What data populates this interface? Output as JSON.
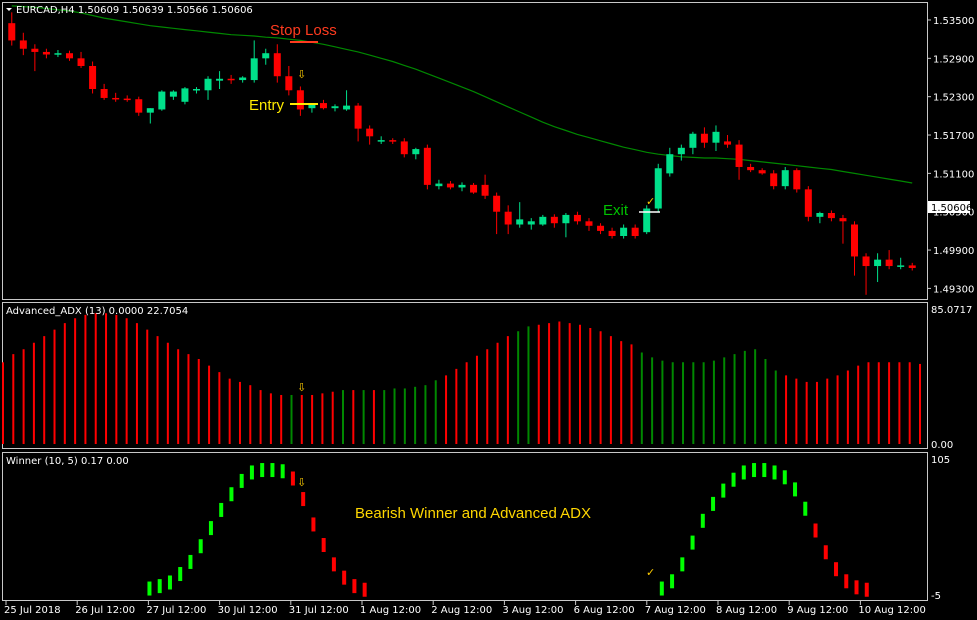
{
  "chart_data": [
    {
      "type": "candlestick",
      "title": "EURCAD,H4 1.50609 1.50639 1.50566 1.50606",
      "y_ticks": [
        "1.53500",
        "1.52900",
        "1.52300",
        "1.51700",
        "1.51100",
        "1.50500",
        "1.49900",
        "1.49300"
      ],
      "ylim": [
        1.4915,
        1.5375
      ],
      "current_price": "1.50606",
      "up_color": "#00e08a",
      "down_color": "#ff0000",
      "ma_color": "#008800",
      "candles": [
        {
          "o": 1.5345,
          "h": 1.5362,
          "l": 1.531,
          "c": 1.5318
        },
        {
          "o": 1.5318,
          "h": 1.533,
          "l": 1.5295,
          "c": 1.5305
        },
        {
          "o": 1.5305,
          "h": 1.5312,
          "l": 1.527,
          "c": 1.53
        },
        {
          "o": 1.53,
          "h": 1.5305,
          "l": 1.529,
          "c": 1.5296
        },
        {
          "o": 1.5296,
          "h": 1.5303,
          "l": 1.5292,
          "c": 1.5298
        },
        {
          "o": 1.5298,
          "h": 1.5302,
          "l": 1.5286,
          "c": 1.529
        },
        {
          "o": 1.529,
          "h": 1.53,
          "l": 1.5275,
          "c": 1.5278
        },
        {
          "o": 1.5278,
          "h": 1.5285,
          "l": 1.5235,
          "c": 1.5242
        },
        {
          "o": 1.5242,
          "h": 1.525,
          "l": 1.5225,
          "c": 1.5228
        },
        {
          "o": 1.5228,
          "h": 1.5236,
          "l": 1.5222,
          "c": 1.5227
        },
        {
          "o": 1.5227,
          "h": 1.5232,
          "l": 1.5222,
          "c": 1.5226
        },
        {
          "o": 1.5226,
          "h": 1.523,
          "l": 1.52,
          "c": 1.5205
        },
        {
          "o": 1.5205,
          "h": 1.5212,
          "l": 1.5188,
          "c": 1.5212
        },
        {
          "o": 1.521,
          "h": 1.524,
          "l": 1.5208,
          "c": 1.5238
        },
        {
          "o": 1.523,
          "h": 1.524,
          "l": 1.5225,
          "c": 1.5238
        },
        {
          "o": 1.5222,
          "h": 1.5245,
          "l": 1.5218,
          "c": 1.5243
        },
        {
          "o": 1.524,
          "h": 1.5245,
          "l": 1.5235,
          "c": 1.5242
        },
        {
          "o": 1.524,
          "h": 1.5262,
          "l": 1.5225,
          "c": 1.5258
        },
        {
          "o": 1.5255,
          "h": 1.527,
          "l": 1.5242,
          "c": 1.5258
        },
        {
          "o": 1.5258,
          "h": 1.5264,
          "l": 1.525,
          "c": 1.5256
        },
        {
          "o": 1.5256,
          "h": 1.5262,
          "l": 1.5252,
          "c": 1.526
        },
        {
          "o": 1.5256,
          "h": 1.5318,
          "l": 1.5252,
          "c": 1.529
        },
        {
          "o": 1.529,
          "h": 1.5305,
          "l": 1.528,
          "c": 1.5298
        },
        {
          "o": 1.5298,
          "h": 1.5312,
          "l": 1.5252,
          "c": 1.5262
        },
        {
          "o": 1.5262,
          "h": 1.5278,
          "l": 1.5232,
          "c": 1.524
        },
        {
          "o": 1.524,
          "h": 1.5246,
          "l": 1.52,
          "c": 1.521
        },
        {
          "o": 1.5212,
          "h": 1.522,
          "l": 1.5205,
          "c": 1.522
        },
        {
          "o": 1.522,
          "h": 1.5225,
          "l": 1.521,
          "c": 1.5212
        },
        {
          "o": 1.5212,
          "h": 1.5218,
          "l": 1.5207,
          "c": 1.5215
        },
        {
          "o": 1.521,
          "h": 1.524,
          "l": 1.5208,
          "c": 1.5216
        },
        {
          "o": 1.5216,
          "h": 1.522,
          "l": 1.516,
          "c": 1.518
        },
        {
          "o": 1.518,
          "h": 1.5185,
          "l": 1.5155,
          "c": 1.5168
        },
        {
          "o": 1.516,
          "h": 1.5168,
          "l": 1.5156,
          "c": 1.5162
        },
        {
          "o": 1.5162,
          "h": 1.5165,
          "l": 1.5156,
          "c": 1.516
        },
        {
          "o": 1.516,
          "h": 1.5165,
          "l": 1.5135,
          "c": 1.514
        },
        {
          "o": 1.514,
          "h": 1.515,
          "l": 1.5132,
          "c": 1.5148
        },
        {
          "o": 1.515,
          "h": 1.5155,
          "l": 1.5085,
          "c": 1.5092
        },
        {
          "o": 1.509,
          "h": 1.51,
          "l": 1.5085,
          "c": 1.5094
        },
        {
          "o": 1.5094,
          "h": 1.5098,
          "l": 1.5085,
          "c": 1.5088
        },
        {
          "o": 1.5088,
          "h": 1.5096,
          "l": 1.5082,
          "c": 1.5092
        },
        {
          "o": 1.5092,
          "h": 1.5095,
          "l": 1.5078,
          "c": 1.508
        },
        {
          "o": 1.5092,
          "h": 1.5108,
          "l": 1.507,
          "c": 1.5075
        },
        {
          "o": 1.5075,
          "h": 1.508,
          "l": 1.5015,
          "c": 1.505
        },
        {
          "o": 1.505,
          "h": 1.506,
          "l": 1.5015,
          "c": 1.503
        },
        {
          "o": 1.503,
          "h": 1.5065,
          "l": 1.5025,
          "c": 1.5038
        },
        {
          "o": 1.503,
          "h": 1.504,
          "l": 1.5022,
          "c": 1.5035
        },
        {
          "o": 1.503,
          "h": 1.5045,
          "l": 1.5028,
          "c": 1.5042
        },
        {
          "o": 1.5042,
          "h": 1.5046,
          "l": 1.5025,
          "c": 1.5032
        },
        {
          "o": 1.5032,
          "h": 1.5048,
          "l": 1.501,
          "c": 1.5045
        },
        {
          "o": 1.5045,
          "h": 1.505,
          "l": 1.503,
          "c": 1.5035
        },
        {
          "o": 1.5035,
          "h": 1.504,
          "l": 1.502,
          "c": 1.5028
        },
        {
          "o": 1.5028,
          "h": 1.5032,
          "l": 1.5015,
          "c": 1.502
        },
        {
          "o": 1.502,
          "h": 1.5025,
          "l": 1.5008,
          "c": 1.5012
        },
        {
          "o": 1.5012,
          "h": 1.503,
          "l": 1.5008,
          "c": 1.5025
        },
        {
          "o": 1.5025,
          "h": 1.503,
          "l": 1.5008,
          "c": 1.5012
        },
        {
          "o": 1.5018,
          "h": 1.506,
          "l": 1.5015,
          "c": 1.5055
        },
        {
          "o": 1.5055,
          "h": 1.5125,
          "l": 1.505,
          "c": 1.5118
        },
        {
          "o": 1.511,
          "h": 1.515,
          "l": 1.5105,
          "c": 1.514
        },
        {
          "o": 1.514,
          "h": 1.5155,
          "l": 1.513,
          "c": 1.515
        },
        {
          "o": 1.515,
          "h": 1.5175,
          "l": 1.514,
          "c": 1.5172
        },
        {
          "o": 1.5172,
          "h": 1.5182,
          "l": 1.515,
          "c": 1.5158
        },
        {
          "o": 1.5158,
          "h": 1.5185,
          "l": 1.5145,
          "c": 1.5175
        },
        {
          "o": 1.516,
          "h": 1.517,
          "l": 1.515,
          "c": 1.5155
        },
        {
          "o": 1.5155,
          "h": 1.5162,
          "l": 1.51,
          "c": 1.512
        },
        {
          "o": 1.512,
          "h": 1.5125,
          "l": 1.5112,
          "c": 1.5115
        },
        {
          "o": 1.5115,
          "h": 1.5118,
          "l": 1.5108,
          "c": 1.511
        },
        {
          "o": 1.511,
          "h": 1.5115,
          "l": 1.5085,
          "c": 1.509
        },
        {
          "o": 1.509,
          "h": 1.512,
          "l": 1.5085,
          "c": 1.5115
        },
        {
          "o": 1.5115,
          "h": 1.5118,
          "l": 1.508,
          "c": 1.5085
        },
        {
          "o": 1.5085,
          "h": 1.509,
          "l": 1.5035,
          "c": 1.5042
        },
        {
          "o": 1.5042,
          "h": 1.505,
          "l": 1.5032,
          "c": 1.5048
        },
        {
          "o": 1.5048,
          "h": 1.5052,
          "l": 1.5035,
          "c": 1.504
        },
        {
          "o": 1.504,
          "h": 1.5045,
          "l": 1.5,
          "c": 1.5035
        },
        {
          "o": 1.503,
          "h": 1.5035,
          "l": 1.495,
          "c": 1.498
        },
        {
          "o": 1.498,
          "h": 1.4985,
          "l": 1.492,
          "c": 1.4965
        },
        {
          "o": 1.4965,
          "h": 1.4985,
          "l": 1.494,
          "c": 1.4975
        },
        {
          "o": 1.4975,
          "h": 1.499,
          "l": 1.496,
          "c": 1.4965
        },
        {
          "o": 1.4965,
          "h": 1.4978,
          "l": 1.496,
          "c": 1.4966
        },
        {
          "o": 1.4966,
          "h": 1.497,
          "l": 1.4958,
          "c": 1.4962
        }
      ],
      "ma": [
        1.5372,
        1.5371,
        1.537,
        1.5368,
        1.5366,
        1.5364,
        1.5361,
        1.5357,
        1.5353,
        1.535,
        1.5347,
        1.5344,
        1.5341,
        1.5339,
        1.5337,
        1.5335,
        1.5333,
        1.5331,
        1.5329,
        1.5327,
        1.5326,
        1.5325,
        1.5323,
        1.5322,
        1.532,
        1.5318,
        1.5315,
        1.5312,
        1.5308,
        1.5304,
        1.53,
        1.5295,
        1.529,
        1.5285,
        1.5279,
        1.5273,
        1.5266,
        1.5259,
        1.5252,
        1.5245,
        1.5238,
        1.523,
        1.5222,
        1.5214,
        1.5206,
        1.5198,
        1.519,
        1.5183,
        1.5177,
        1.5171,
        1.5166,
        1.5161,
        1.5156,
        1.5151,
        1.5147,
        1.5143,
        1.514,
        1.5138,
        1.5136,
        1.5135,
        1.5134,
        1.5134,
        1.5133,
        1.5132,
        1.513,
        1.5128,
        1.5126,
        1.5124,
        1.5122,
        1.512,
        1.5118,
        1.5116,
        1.5113,
        1.511,
        1.5107,
        1.5104,
        1.5101,
        1.5098,
        1.5095
      ],
      "annotations": {
        "stop_loss": "Stop Loss",
        "entry": "Entry",
        "exit": "Exit"
      }
    },
    {
      "type": "histogram",
      "title": "Advanced_ADX (13) 0.0000 22.7054",
      "y_top_label": "85.0717",
      "y_bottom_label": "0.00",
      "ylim": [
        0,
        85.0717
      ],
      "up_color": "#008800",
      "down_color": "#ff0000",
      "values": [
        50,
        55,
        58,
        62,
        66,
        70,
        74,
        77,
        79,
        80,
        80,
        79,
        77,
        74,
        70,
        66,
        62,
        58,
        55,
        52,
        48,
        44,
        40,
        38,
        36,
        33,
        31,
        30,
        30,
        30,
        30,
        31,
        32,
        33,
        33,
        33,
        33,
        33,
        34,
        34,
        35,
        36,
        39,
        42,
        46,
        50,
        54,
        58,
        62,
        66,
        69,
        72,
        73,
        74,
        75,
        74,
        73,
        71,
        69,
        66,
        63,
        61,
        56,
        53,
        51,
        50,
        50,
        50,
        50,
        51,
        53,
        55,
        57,
        58,
        52,
        45,
        42,
        40,
        38,
        38,
        40,
        42,
        45,
        48,
        50,
        50,
        50,
        50,
        50,
        49
      ],
      "greens": [
        28,
        33,
        35,
        37,
        38,
        39,
        40,
        41,
        42,
        50,
        51,
        62,
        63,
        64,
        65,
        66,
        67,
        68,
        69,
        70,
        71,
        72,
        73,
        74,
        75
      ],
      "marker_index": 36
    },
    {
      "type": "histogram",
      "title": "Winner (10, 5) 0.17 0.00",
      "y_top_label": "105",
      "y_bottom_label": "-5",
      "ylim": [
        -5,
        105
      ],
      "up_color": "#00ff00",
      "down_color": "#ff0000",
      "values": [
        0,
        0,
        0,
        0,
        0,
        0,
        0,
        0,
        0,
        0,
        0,
        0,
        0,
        0,
        2,
        4,
        7,
        14,
        24,
        37,
        52,
        67,
        80,
        91,
        98,
        100,
        100,
        99,
        93,
        76,
        55,
        38,
        22,
        11,
        4,
        1,
        0,
        0,
        0,
        0,
        0,
        0,
        0,
        0,
        0,
        0,
        0,
        0,
        0,
        0,
        0,
        0,
        0,
        0,
        0,
        0,
        0,
        0,
        0,
        0,
        0,
        0,
        0,
        0,
        2,
        8,
        22,
        40,
        58,
        72,
        83,
        92,
        98,
        100,
        100,
        98,
        94,
        84,
        68,
        50,
        32,
        18,
        8,
        3,
        1,
        0,
        0,
        0,
        0,
        0
      ],
      "colors": "ggggggggggggggggggggggggggggrrrrrrrrrrrrrrrrrrrrrrrrrrrrrrrrrrrrgggggggggggggggrrrrrrrrrrrrrr",
      "annotation": "Bearish Winner and Advanced ADX"
    }
  ],
  "x_axis_labels": [
    "25 Jul 2018",
    "26 Jul 12:00",
    "27 Jul 12:00",
    "30 Jul 12:00",
    "31 Jul 12:00",
    "1 Aug 12:00",
    "2 Aug 12:00",
    "3 Aug 12:00",
    "6 Aug 12:00",
    "7 Aug 12:00",
    "8 Aug 12:00",
    "9 Aug 12:00",
    "10 Aug 12:00"
  ]
}
